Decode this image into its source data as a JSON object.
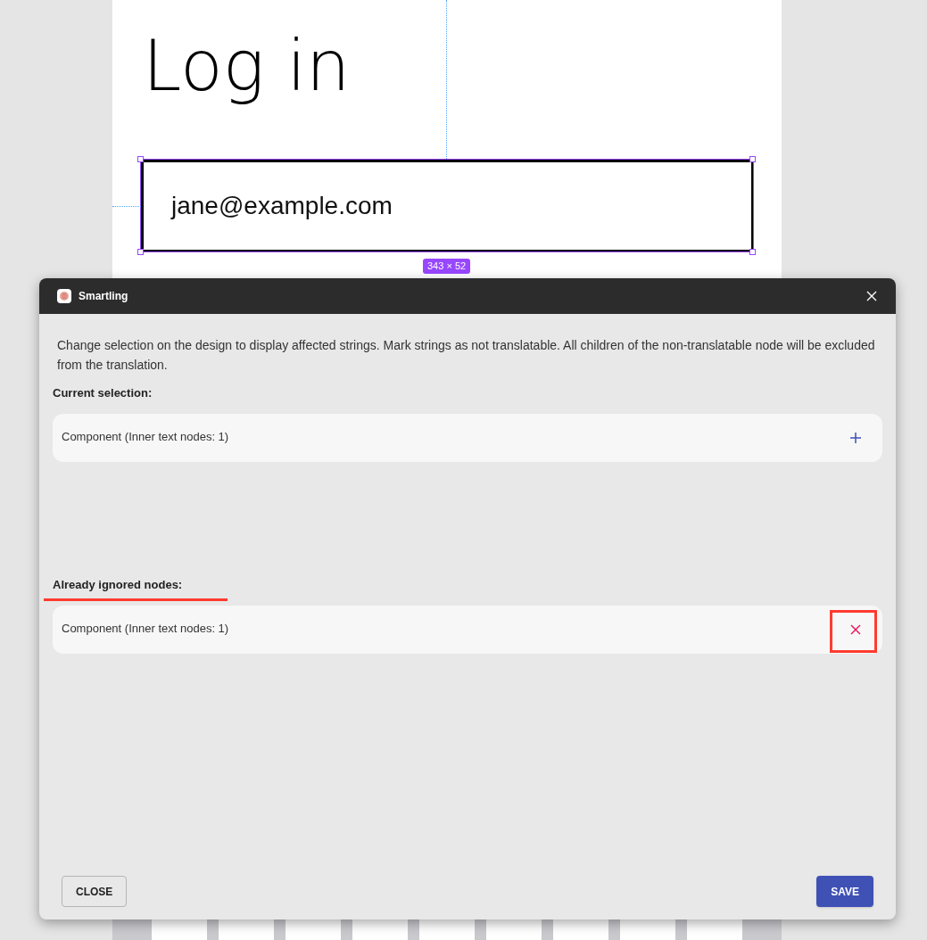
{
  "canvas": {
    "title": "Log in",
    "input_value": "jane@example.com",
    "size_badge": "343 × 52"
  },
  "dialog": {
    "title": "Smartling",
    "description": "Change selection on the design to display affected strings. Mark strings as not translatable. All children of the non-translatable node will be excluded from the translation.",
    "sections": [
      {
        "heading": "Current selection:",
        "items": [
          {
            "label": "Component (Inner text nodes: 1)",
            "kind": "add"
          }
        ]
      },
      {
        "heading": "Already ignored nodes:",
        "items": [
          {
            "label": "Component (Inner text nodes: 1)",
            "kind": "remove"
          }
        ]
      }
    ],
    "buttons": [
      {
        "label": "CLOSE",
        "kind": "secondary"
      },
      {
        "label": "SAVE",
        "kind": "primary"
      }
    ]
  }
}
